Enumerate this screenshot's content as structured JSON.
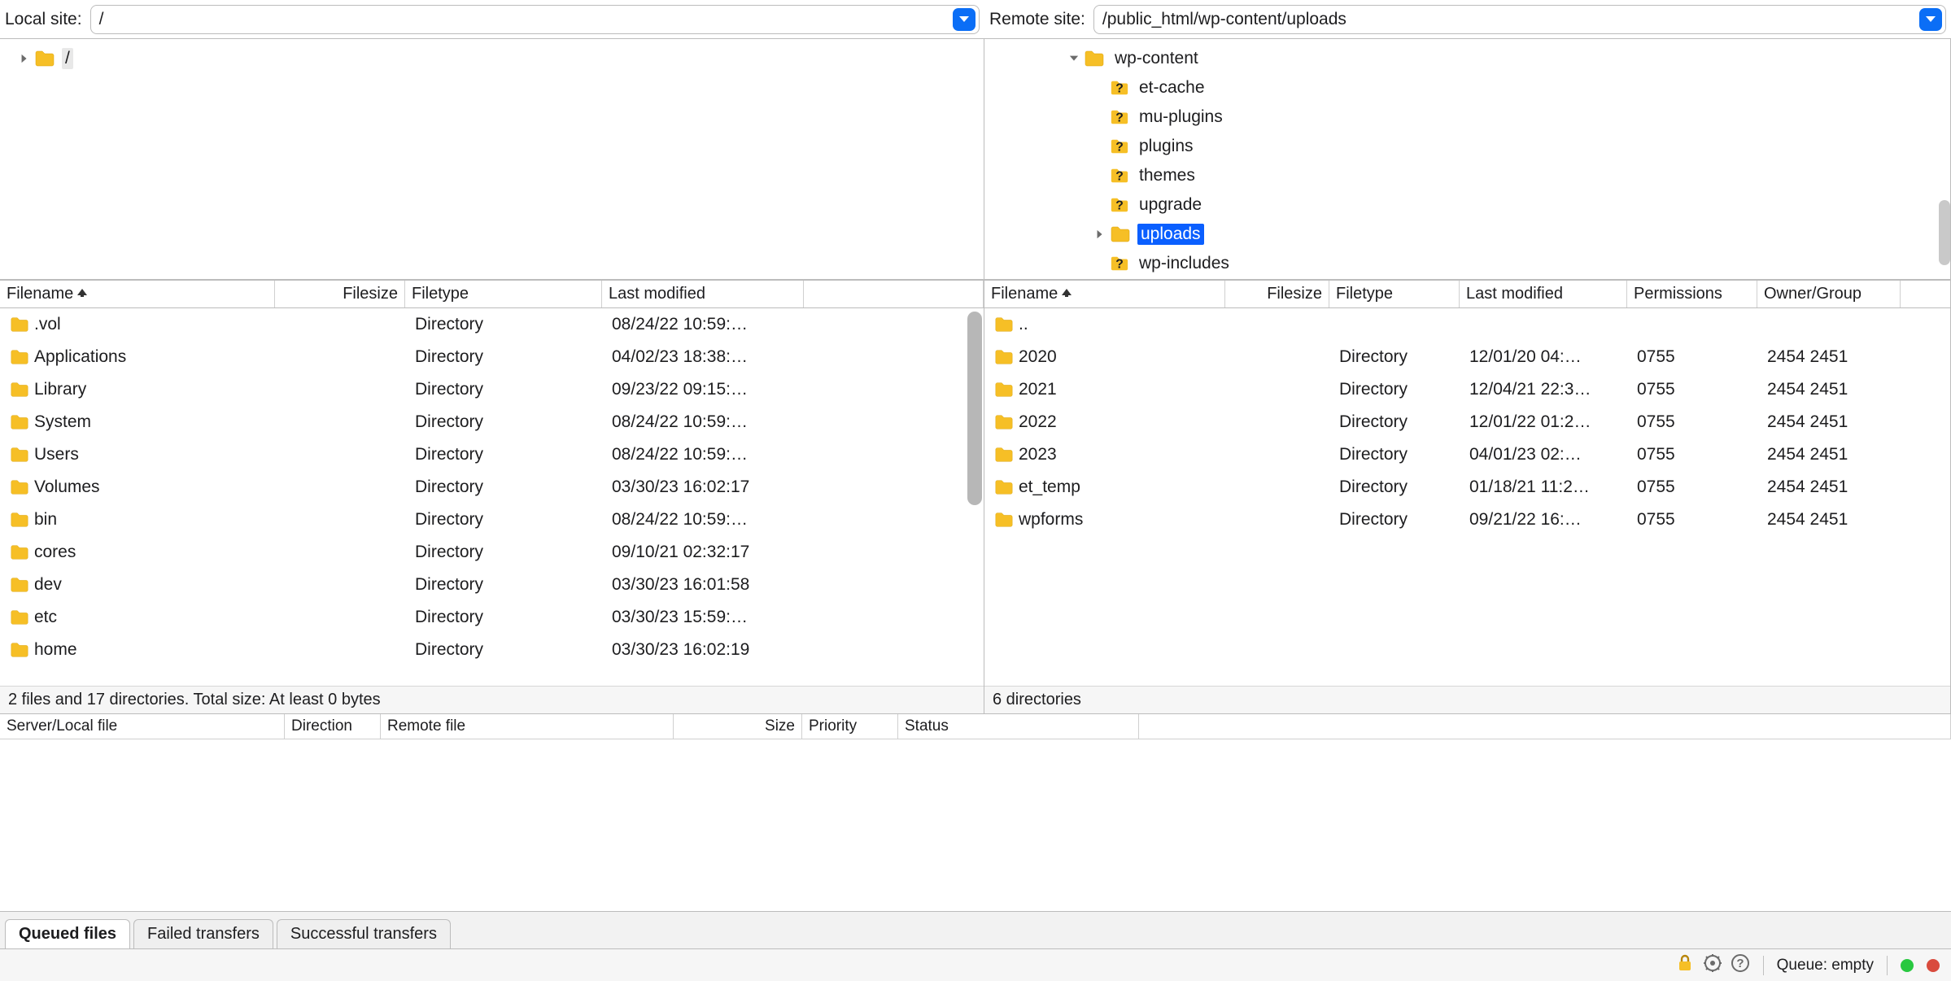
{
  "local": {
    "label": "Local site:",
    "path": "/",
    "tree_root": "/",
    "columns": {
      "name": "Filename",
      "size": "Filesize",
      "type": "Filetype",
      "mod": "Last modified"
    },
    "files": [
      {
        "name": ".vol",
        "type": "Directory",
        "mod": "08/24/22 10:59:…"
      },
      {
        "name": "Applications",
        "type": "Directory",
        "mod": "04/02/23 18:38:…"
      },
      {
        "name": "Library",
        "type": "Directory",
        "mod": "09/23/22 09:15:…"
      },
      {
        "name": "System",
        "type": "Directory",
        "mod": "08/24/22 10:59:…"
      },
      {
        "name": "Users",
        "type": "Directory",
        "mod": "08/24/22 10:59:…"
      },
      {
        "name": "Volumes",
        "type": "Directory",
        "mod": "03/30/23 16:02:17"
      },
      {
        "name": "bin",
        "type": "Directory",
        "mod": "08/24/22 10:59:…"
      },
      {
        "name": "cores",
        "type": "Directory",
        "mod": "09/10/21 02:32:17"
      },
      {
        "name": "dev",
        "type": "Directory",
        "mod": "03/30/23 16:01:58"
      },
      {
        "name": "etc",
        "type": "Directory",
        "mod": "03/30/23 15:59:…"
      },
      {
        "name": "home",
        "type": "Directory",
        "mod": "03/30/23 16:02:19"
      }
    ],
    "status": "2 files and 17 directories. Total size: At least 0 bytes"
  },
  "remote": {
    "label": "Remote site:",
    "path": "/public_html/wp-content/uploads",
    "tree": {
      "root": "wp-content",
      "children": [
        {
          "name": "et-cache",
          "unknown": true
        },
        {
          "name": "mu-plugins",
          "unknown": true
        },
        {
          "name": "plugins",
          "unknown": true
        },
        {
          "name": "themes",
          "unknown": true
        },
        {
          "name": "upgrade",
          "unknown": true
        },
        {
          "name": "uploads",
          "unknown": false,
          "selected": true
        },
        {
          "name": "wp-includes",
          "unknown": true
        }
      ]
    },
    "columns": {
      "name": "Filename",
      "size": "Filesize",
      "type": "Filetype",
      "mod": "Last modified",
      "perm": "Permissions",
      "own": "Owner/Group"
    },
    "files": [
      {
        "name": "..",
        "parent": true
      },
      {
        "name": "2020",
        "type": "Directory",
        "mod": "12/01/20 04:…",
        "perm": "0755",
        "own": "2454 2451"
      },
      {
        "name": "2021",
        "type": "Directory",
        "mod": "12/04/21 22:3…",
        "perm": "0755",
        "own": "2454 2451"
      },
      {
        "name": "2022",
        "type": "Directory",
        "mod": "12/01/22 01:2…",
        "perm": "0755",
        "own": "2454 2451"
      },
      {
        "name": "2023",
        "type": "Directory",
        "mod": "04/01/23 02:…",
        "perm": "0755",
        "own": "2454 2451"
      },
      {
        "name": "et_temp",
        "type": "Directory",
        "mod": "01/18/21 11:2…",
        "perm": "0755",
        "own": "2454 2451"
      },
      {
        "name": "wpforms",
        "type": "Directory",
        "mod": "09/21/22 16:…",
        "perm": "0755",
        "own": "2454 2451"
      }
    ],
    "status": "6 directories"
  },
  "queue": {
    "columns": {
      "file": "Server/Local file",
      "dir": "Direction",
      "remote": "Remote file",
      "size": "Size",
      "pri": "Priority",
      "stat": "Status"
    }
  },
  "tabs": {
    "queued": "Queued files",
    "failed": "Failed transfers",
    "success": "Successful transfers"
  },
  "statusbar": {
    "queue": "Queue: empty"
  },
  "icons": {
    "folder_color": "#f6bf26",
    "folder_stroke": "#e0a800"
  }
}
